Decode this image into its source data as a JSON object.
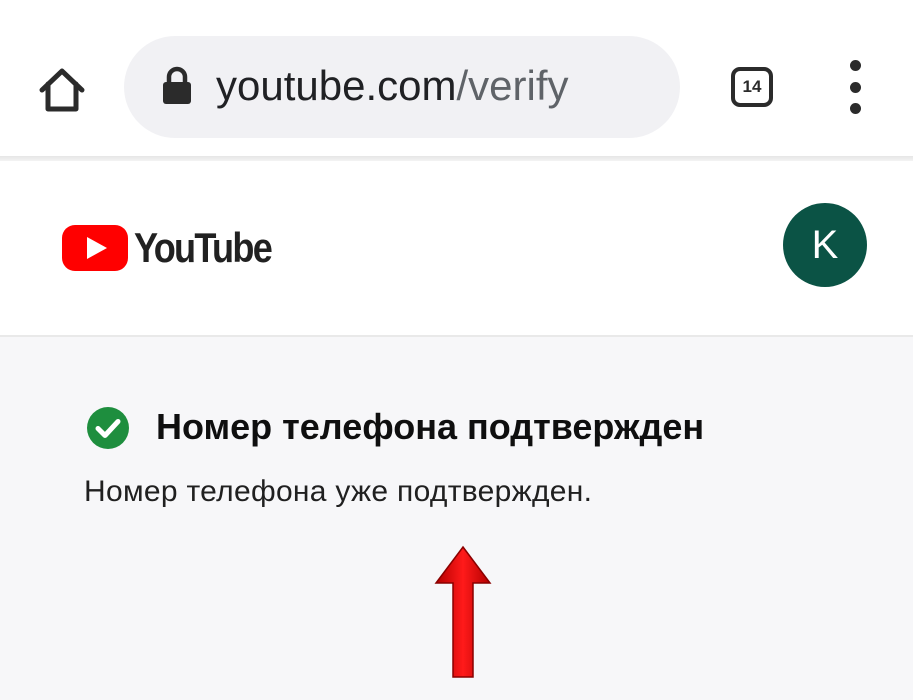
{
  "browser": {
    "url_domain": "youtube.com",
    "url_path": "/verify",
    "tab_count": "14",
    "icons": {
      "home": "home-icon",
      "lock": "lock-icon",
      "tabs": "tabs-icon",
      "menu": "more-vert-icon"
    }
  },
  "header": {
    "logo_text": "YouTube",
    "avatar_letter": "K",
    "colors": {
      "logo_red": "#ff0000",
      "avatar_bg": "#0b5345"
    }
  },
  "main": {
    "title": "Номер телефона подтвержден",
    "message": "Номер телефона уже подтвержден.",
    "status_icon": "check-circle-icon",
    "annotation_icon": "red-arrow-up-icon",
    "colors": {
      "success": "#1e8e3e",
      "annotation": "#e00000"
    }
  }
}
